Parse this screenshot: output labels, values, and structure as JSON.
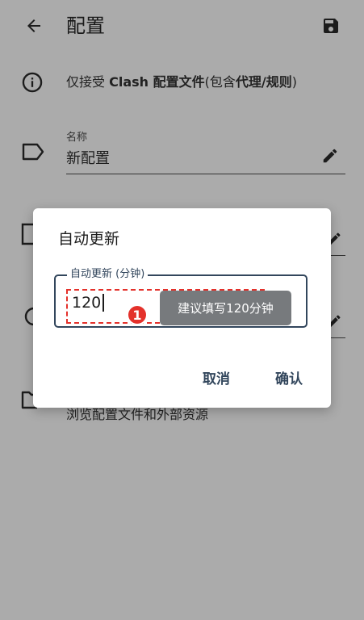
{
  "appbar": {
    "title": "配置",
    "back_icon": "arrow-left-icon",
    "save_icon": "save-icon"
  },
  "info": {
    "icon": "info-icon",
    "prefix": "仅接受 ",
    "bold1": "Clash 配置文件",
    "middle": "(包含",
    "bold2": "代理/规则",
    "suffix": ")"
  },
  "name_field": {
    "icon": "label-tag-icon",
    "label": "名称",
    "value": "新配置",
    "edit_icon": "pencil-icon"
  },
  "browse": {
    "icon": "folder-icon",
    "text": "浏览配置文件和外部资源"
  },
  "dialog": {
    "title": "自动更新",
    "field_label": "自动更新 (分钟)",
    "field_value": "120",
    "annotation_number": "1",
    "tooltip": "建议填写120分钟",
    "cancel_label": "取消",
    "confirm_label": "确认"
  },
  "colors": {
    "scrim": "#ababab",
    "accent": "#32465c",
    "annotation_red": "#e4312b",
    "tooltip_bg": "#777a7d"
  }
}
